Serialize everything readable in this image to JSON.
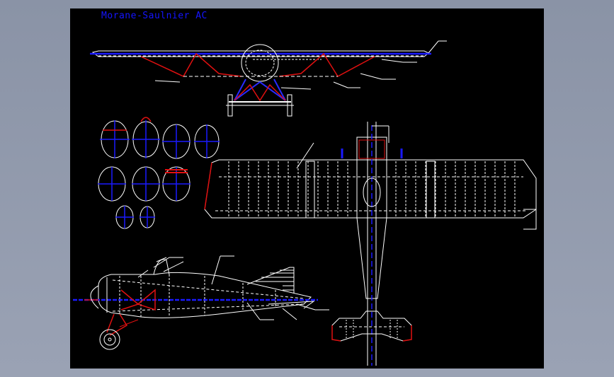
{
  "drawing": {
    "title": "Morane-Saulnier AC"
  },
  "colors": {
    "background": "#000000",
    "frame": "#959eb0",
    "line": "#ffffff",
    "centerline": "#1a1aff",
    "accent": "#e01010"
  },
  "views": [
    "front-view",
    "fuselage-cross-sections",
    "top-view",
    "side-view"
  ]
}
